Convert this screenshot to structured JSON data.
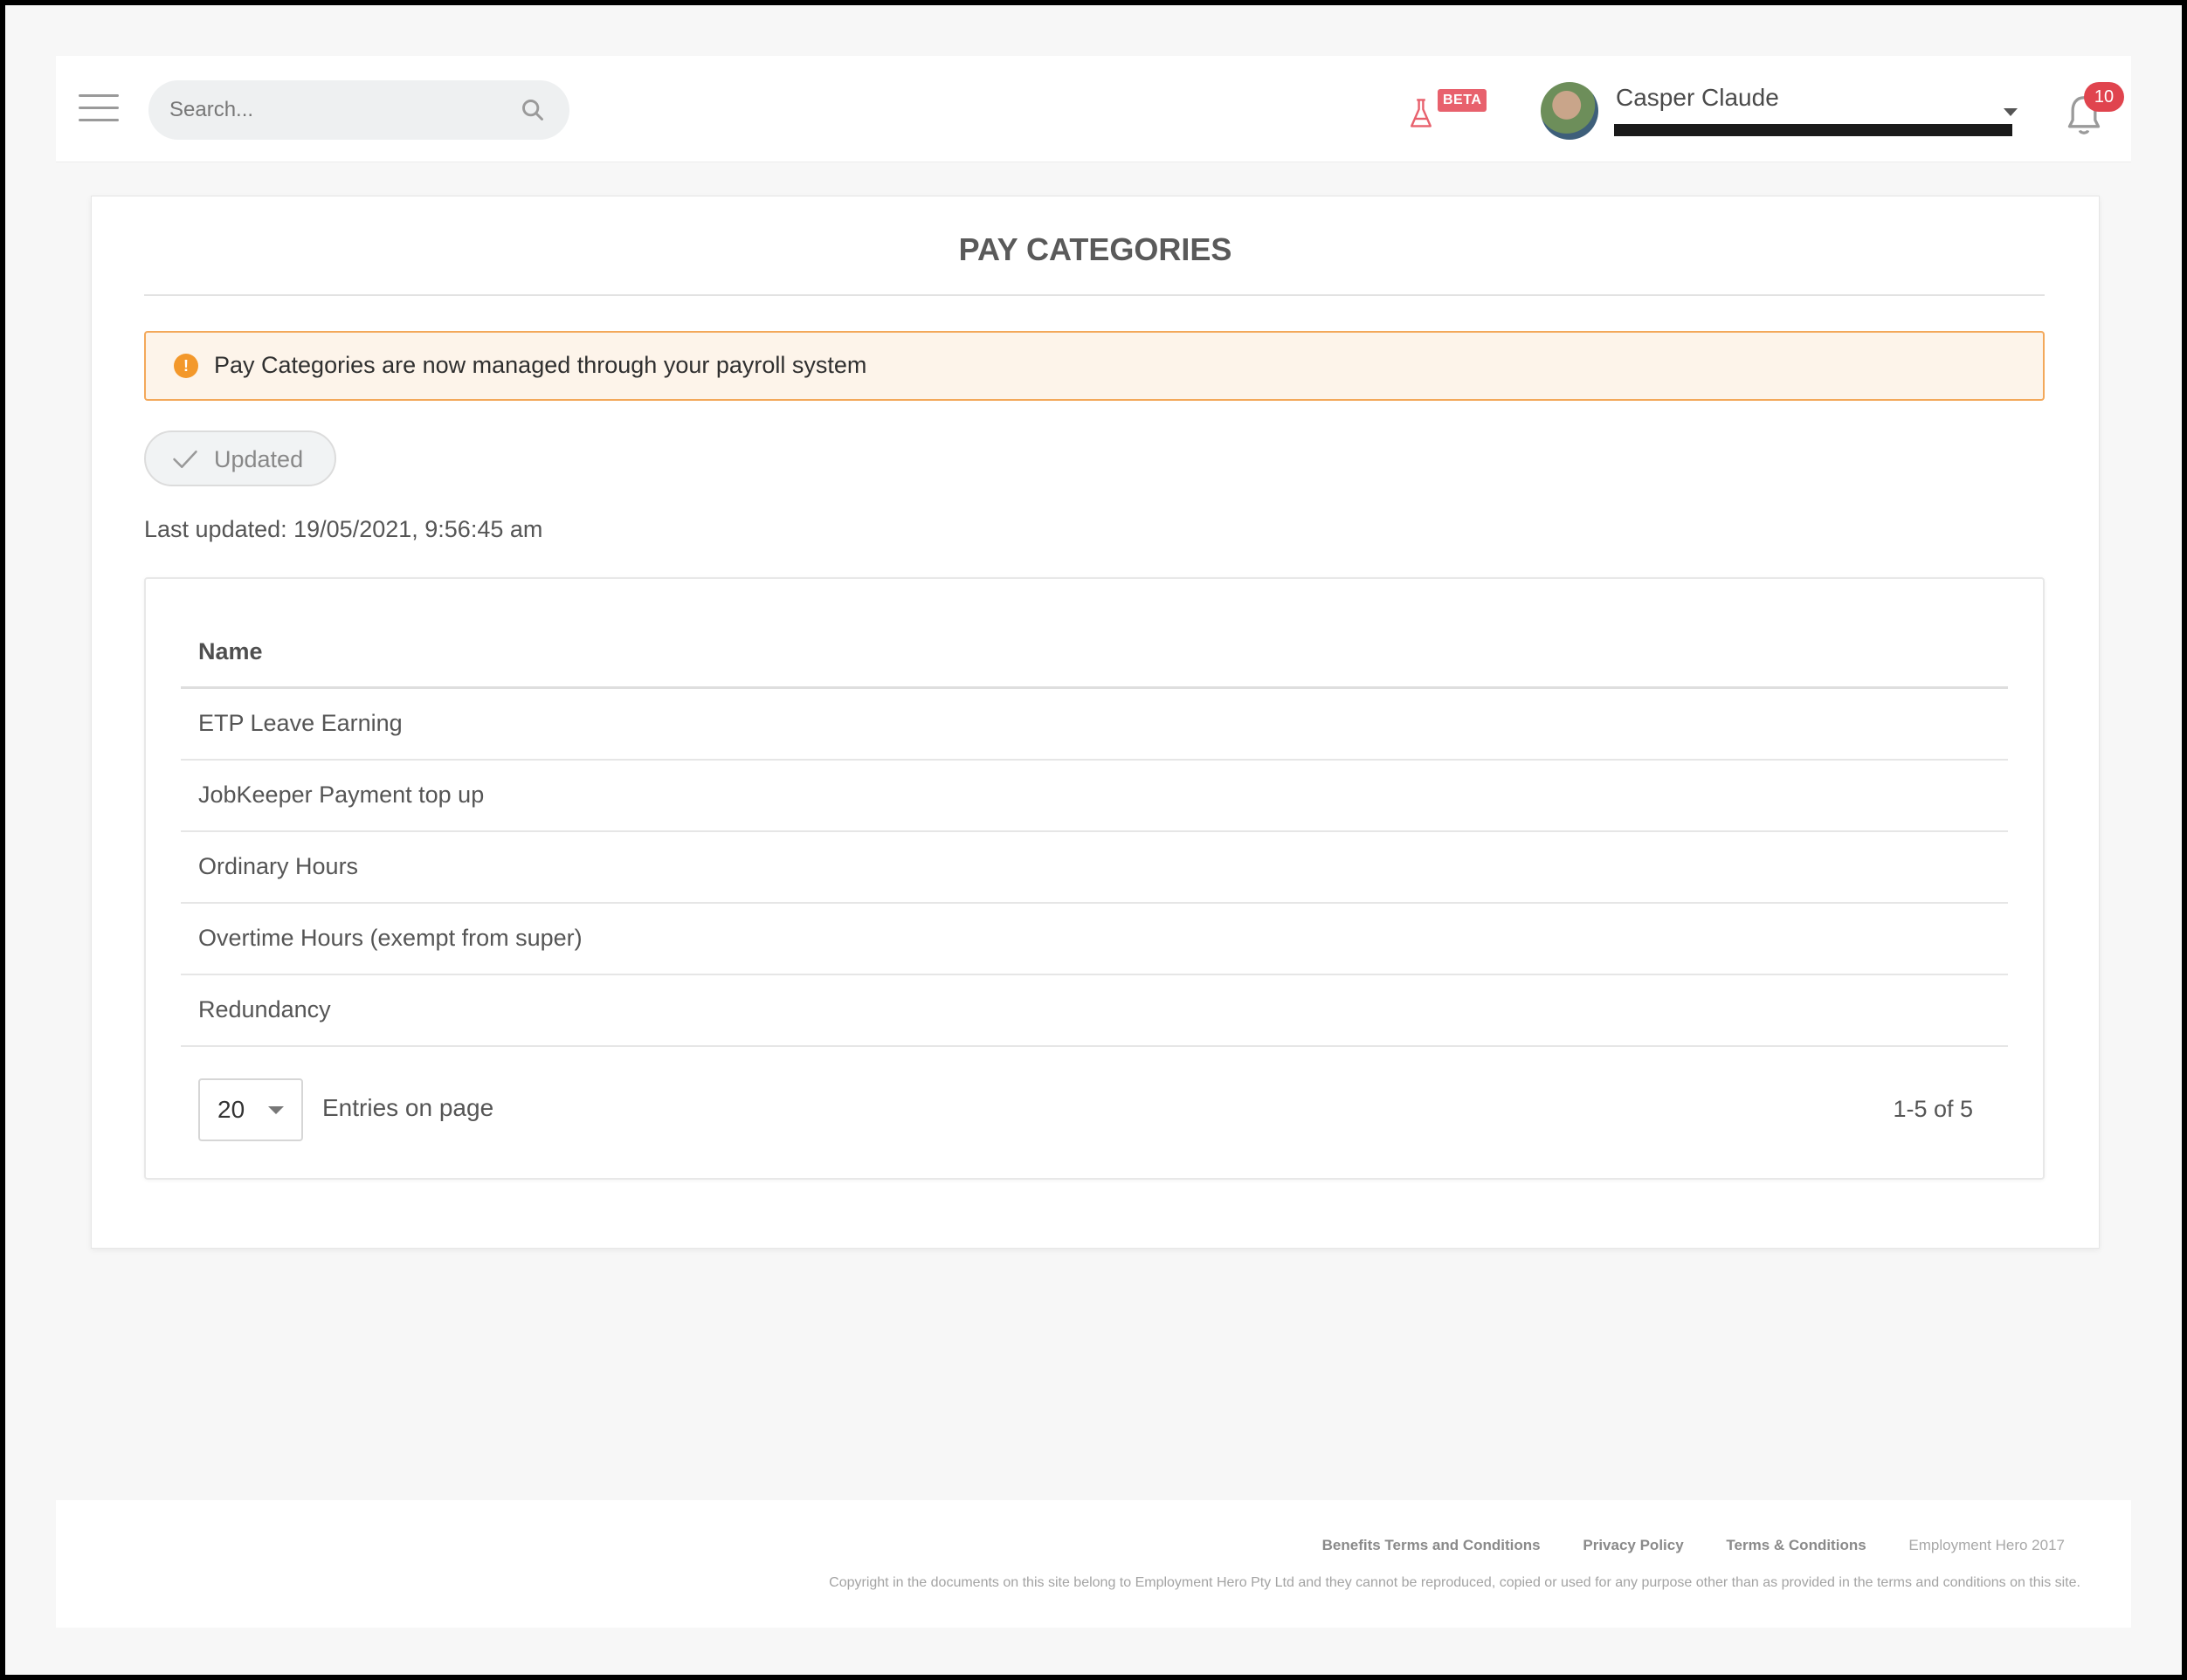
{
  "header": {
    "search_placeholder": "Search...",
    "beta_label": "BETA",
    "user_name": "Casper Claude",
    "notification_count": "10"
  },
  "page": {
    "title": "PAY CATEGORIES",
    "alert_text": "Pay Categories are now managed through your payroll system",
    "alert_icon_glyph": "!",
    "updated_label": "Updated",
    "last_updated": "Last updated: 19/05/2021, 9:56:45 am"
  },
  "table": {
    "column_header": "Name",
    "rows": [
      "ETP Leave Earning",
      "JobKeeper Payment top up",
      "Ordinary Hours",
      "Overtime Hours (exempt from super)",
      "Redundancy"
    ],
    "page_size": "20",
    "entries_label": "Entries on page",
    "range": "1-5 of 5"
  },
  "footer": {
    "links": [
      "Benefits Terms and Conditions",
      "Privacy Policy",
      "Terms & Conditions"
    ],
    "brand": "Employment Hero 2017",
    "copyright": "Copyright in the documents on this site belong to Employment Hero Pty Ltd and they cannot be reproduced, copied or used for any purpose other than as provided in the terms and conditions on this site."
  },
  "colors": {
    "alert_border": "#f3a85a",
    "alert_bg": "#fdf4ea",
    "badge_red": "#e0444e",
    "beta_pink": "#e8616d"
  },
  "icons": [
    "menu-icon",
    "search-icon",
    "flask-icon",
    "chevron-down-icon",
    "bell-icon",
    "warning-icon",
    "check-icon"
  ]
}
